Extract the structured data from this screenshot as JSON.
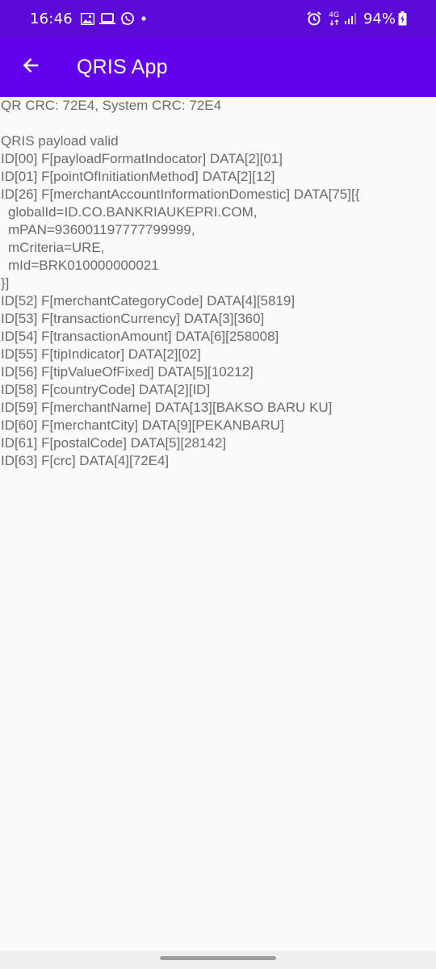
{
  "status_bar": {
    "time": "16:46",
    "network_label": "4G",
    "battery_percent": "94%",
    "icons": [
      "image-icon",
      "laptop-icon",
      "whatsapp-icon",
      "dot-icon",
      "alarm-icon",
      "network-4g-icon",
      "signal-icon",
      "battery-charging-icon"
    ]
  },
  "app_bar": {
    "title": "QRIS App",
    "back_icon": "arrow-left-icon",
    "background": "#6200ee"
  },
  "content": {
    "lines": [
      "QR CRC: 72E4, System CRC: 72E4",
      "",
      "QRIS payload valid",
      "ID[00] F[payloadFormatIndocator] DATA[2][01]",
      "ID[01] F[pointOfInitiationMethod] DATA[2][12]",
      "ID[26] F[merchantAccountInformationDomestic] DATA[75][{",
      "globalId=ID.CO.BANKRIAUKEPRI.COM,",
      "mPAN=936001197777799999,",
      "mCriteria=URE,",
      "mId=BRK010000000021",
      "}]",
      "ID[52] F[merchantCategoryCode] DATA[4][5819]",
      "ID[53] F[transactionCurrency] DATA[3][360]",
      "ID[54] F[transactionAmount] DATA[6][258008]",
      "ID[55] F[tipIndicator] DATA[2][02]",
      "ID[56] F[tipValueOfFixed] DATA[5][10212]",
      "ID[58] F[countryCode] DATA[2][ID]",
      "ID[59] F[merchantName] DATA[13][BAKSO BARU KU]",
      "ID[60] F[merchantCity] DATA[9][PEKANBARU]",
      "ID[61] F[postalCode] DATA[5][28142]",
      "ID[63] F[crc] DATA[4][72E4]"
    ]
  }
}
